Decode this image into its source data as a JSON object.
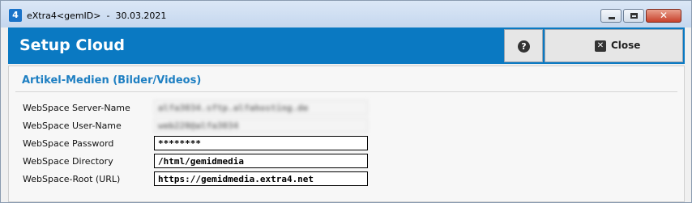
{
  "window": {
    "title": "eXtra4<gemID>  -  30.03.2021",
    "app_icon_glyph": "4",
    "minimize_icon": "minimize-icon",
    "maximize_icon": "maximize-icon",
    "close_glyph": "✕"
  },
  "header": {
    "title": "Setup Cloud",
    "help_glyph": "?",
    "close_label": "Close",
    "close_glyph": "✕",
    "accent_color": "#0a79c2"
  },
  "section": {
    "title": "Artikel-Medien (Bilder/Videos)",
    "title_color": "#1e7fc2"
  },
  "form": {
    "rows": [
      {
        "label": "WebSpace Server-Name",
        "value": "alfa3034.sftp.alfahosting.de",
        "blurred": true
      },
      {
        "label": "WebSpace User-Name",
        "value": "web220@alfa3034",
        "blurred": true
      },
      {
        "label": "WebSpace Password",
        "value": "********",
        "blurred": false
      },
      {
        "label": "WebSpace Directory",
        "value": "/html/gemidmedia",
        "blurred": false
      },
      {
        "label": "WebSpace-Root (URL)",
        "value": "https://gemidmedia.extra4.net",
        "blurred": false
      }
    ]
  }
}
